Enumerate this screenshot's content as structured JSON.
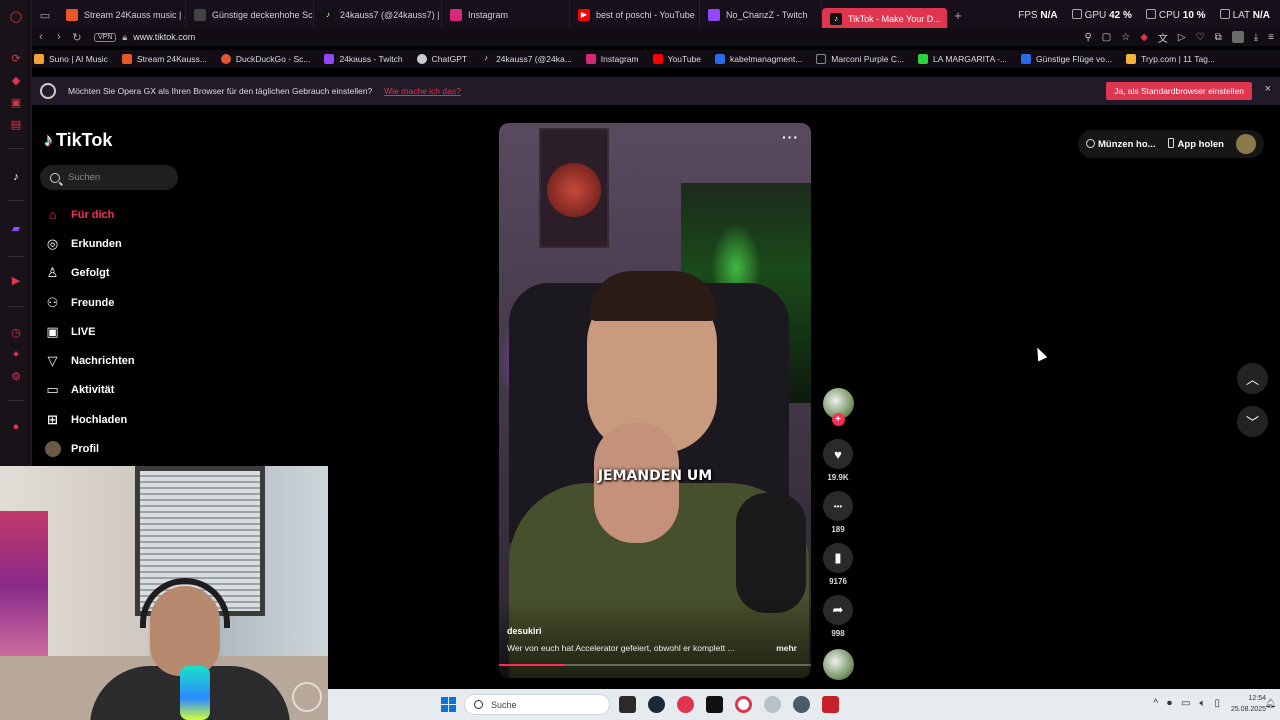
{
  "tabs": [
    {
      "label": "Stream 24Kauss music | ...",
      "fav_color": "#e8572a"
    },
    {
      "label": "Günstige deckenhohe Sc...",
      "fav_color": "#444444"
    },
    {
      "label": "24kauss7 (@24kauss7) |",
      "fav_color": "#111111"
    },
    {
      "label": "Instagram",
      "fav_color": "#d62976"
    },
    {
      "label": "best of poschi - YouTube",
      "fav_color": "#ff0000"
    },
    {
      "label": "No_ChanzZ - Twitch",
      "fav_color": "#9146ff"
    },
    {
      "label": "TikTok - Make Your D...",
      "fav_color": "#111111"
    }
  ],
  "sysmon": {
    "fps_label": "FPS",
    "fps_value": "N/A",
    "gpu_label": "GPU",
    "gpu_value": "42 %",
    "cpu_label": "CPU",
    "cpu_value": "10 %",
    "lat_label": "LAT",
    "lat_value": "N/A"
  },
  "address": {
    "vpn": "VPN",
    "url": "www.tiktok.com"
  },
  "bookmarks": [
    {
      "label": "Suno | AI Music",
      "fav_color": "#f2a33a"
    },
    {
      "label": "Stream 24Kauss...",
      "fav_color": "#e8572a"
    },
    {
      "label": "DuckDuckGo - Sc...",
      "fav_color": "#de5833"
    },
    {
      "label": "24kauss - Twitch",
      "fav_color": "#9146ff"
    },
    {
      "label": "ChatGPT",
      "fav_color": "#cccccc"
    },
    {
      "label": "24kauss7 (@24ka...",
      "fav_color": "#111111"
    },
    {
      "label": "Instagram",
      "fav_color": "#d62976"
    },
    {
      "label": "YouTube",
      "fav_color": "#ff0000"
    },
    {
      "label": "kabelmanagment...",
      "fav_color": "#2a6ae8"
    },
    {
      "label": "Marconi Purple C...",
      "fav_color": "#888888"
    },
    {
      "label": "LA MARGARITA -...",
      "fav_color": "#2ad43a"
    },
    {
      "label": "Günstige Flüge vo...",
      "fav_color": "#2a6ae8"
    },
    {
      "label": "Tryp.com | 11 Tag...",
      "fav_color": "#f2b53a"
    }
  ],
  "prompt": {
    "text": "Möchten Sie Opera GX als Ihren Browser für den täglichen Gebrauch einstellen?",
    "howto": "Wie mache ich das?",
    "yes": "Ja, als Standardbrowser einstellen",
    "close": "×"
  },
  "tiktok": {
    "logo": "TikTok",
    "search_placeholder": "Suchen",
    "nav": [
      {
        "label": "Für dich",
        "icon": "home-icon",
        "glyph": "⌂",
        "active": true
      },
      {
        "label": "Erkunden",
        "icon": "compass-icon",
        "glyph": "◎"
      },
      {
        "label": "Gefolgt",
        "icon": "following-icon",
        "glyph": "♙"
      },
      {
        "label": "Freunde",
        "icon": "friends-icon",
        "glyph": "⚇"
      },
      {
        "label": "LIVE",
        "icon": "live-icon",
        "glyph": "▣"
      },
      {
        "label": "Nachrichten",
        "icon": "messages-icon",
        "glyph": "▽"
      },
      {
        "label": "Aktivität",
        "icon": "activity-icon",
        "glyph": "▭"
      },
      {
        "label": "Hochladen",
        "icon": "upload-icon",
        "glyph": "⊞"
      },
      {
        "label": "Profil",
        "icon": "profile-avatar",
        "glyph": ""
      }
    ],
    "video": {
      "caption": "JEMANDEN UM",
      "author": "desukiri",
      "description": "Wer von euch hat Accelerator gefeiert, obwohl er komplett ...",
      "more": "mehr",
      "progress": 0.21
    },
    "actions": [
      {
        "name": "like",
        "glyph": "♥",
        "count": "19.9K"
      },
      {
        "name": "comment",
        "glyph": "•••",
        "count": "189"
      },
      {
        "name": "bookmark",
        "glyph": "▮",
        "count": "9176"
      },
      {
        "name": "share",
        "glyph": "➦",
        "count": "998"
      }
    ],
    "coins": "Münzen ho...",
    "app": "App holen"
  },
  "taskbar": {
    "search": "Suche",
    "time": "12:54",
    "date": "25.08.2025"
  },
  "colors": {
    "accent": "#e0354f",
    "tiktok_red": "#fe2c55"
  }
}
